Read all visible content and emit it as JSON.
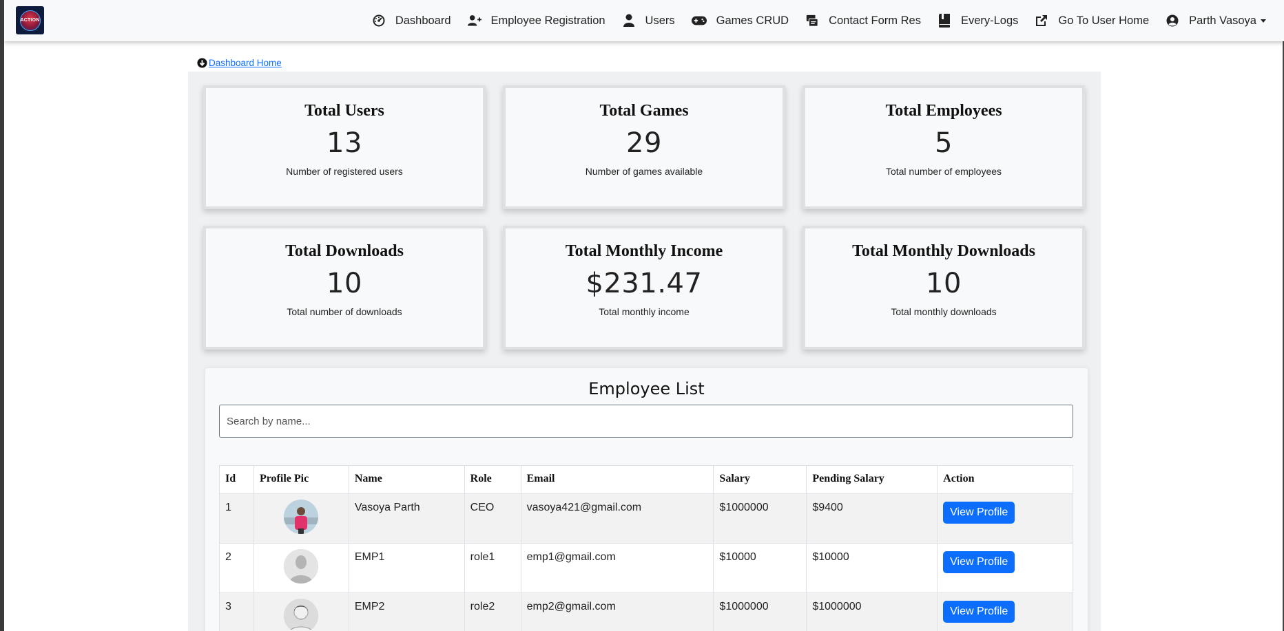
{
  "navbar": {
    "logo_text": "ACTION",
    "items": [
      {
        "label": "Dashboard",
        "icon": "tachometer-icon"
      },
      {
        "label": "Employee Registration",
        "icon": "user-plus-icon"
      },
      {
        "label": "Users",
        "icon": "user-icon"
      },
      {
        "label": "Games CRUD",
        "icon": "gamepad-icon"
      },
      {
        "label": "Contact Form Res",
        "icon": "contact-card-icon"
      },
      {
        "label": "Every-Logs",
        "icon": "book-icon"
      },
      {
        "label": "Go To User Home",
        "icon": "external-link-icon"
      },
      {
        "label": "Parth Vasoya",
        "icon": "user-circle-icon"
      }
    ]
  },
  "breadcrumb": {
    "label": "Dashboard Home"
  },
  "cards": [
    {
      "title": "Total Users",
      "value": "13",
      "desc": "Number of registered users"
    },
    {
      "title": "Total Games",
      "value": "29",
      "desc": "Number of games available"
    },
    {
      "title": "Total Employees",
      "value": "5",
      "desc": "Total number of employees"
    },
    {
      "title": "Total Downloads",
      "value": "10",
      "desc": "Total number of downloads"
    },
    {
      "title": "Total Monthly Income",
      "value": "$231.47",
      "desc": "Total monthly income"
    },
    {
      "title": "Total Monthly Downloads",
      "value": "10",
      "desc": "Total monthly downloads"
    }
  ],
  "employee_list": {
    "title": "Employee List",
    "search_placeholder": "Search by name...",
    "columns": [
      "Id",
      "Profile Pic",
      "Name",
      "Role",
      "Email",
      "Salary",
      "Pending Salary",
      "Action"
    ],
    "rows": [
      {
        "id": "1",
        "name": "Vasoya Parth",
        "role": "CEO",
        "email": "vasoya421@gmail.com",
        "salary": "$1000000",
        "pending": "$9400",
        "action": "View Profile"
      },
      {
        "id": "2",
        "name": "EMP1",
        "role": "role1",
        "email": "emp1@gmail.com",
        "salary": "$10000",
        "pending": "$10000",
        "action": "View Profile"
      },
      {
        "id": "3",
        "name": "EMP2",
        "role": "role2",
        "email": "emp2@gmail.com",
        "salary": "$1000000",
        "pending": "$1000000",
        "action": "View Profile"
      }
    ]
  },
  "colors": {
    "accent": "#0d6efd",
    "navbar_bg": "#f8f9fa",
    "card_bg": "#f8f9fa"
  }
}
